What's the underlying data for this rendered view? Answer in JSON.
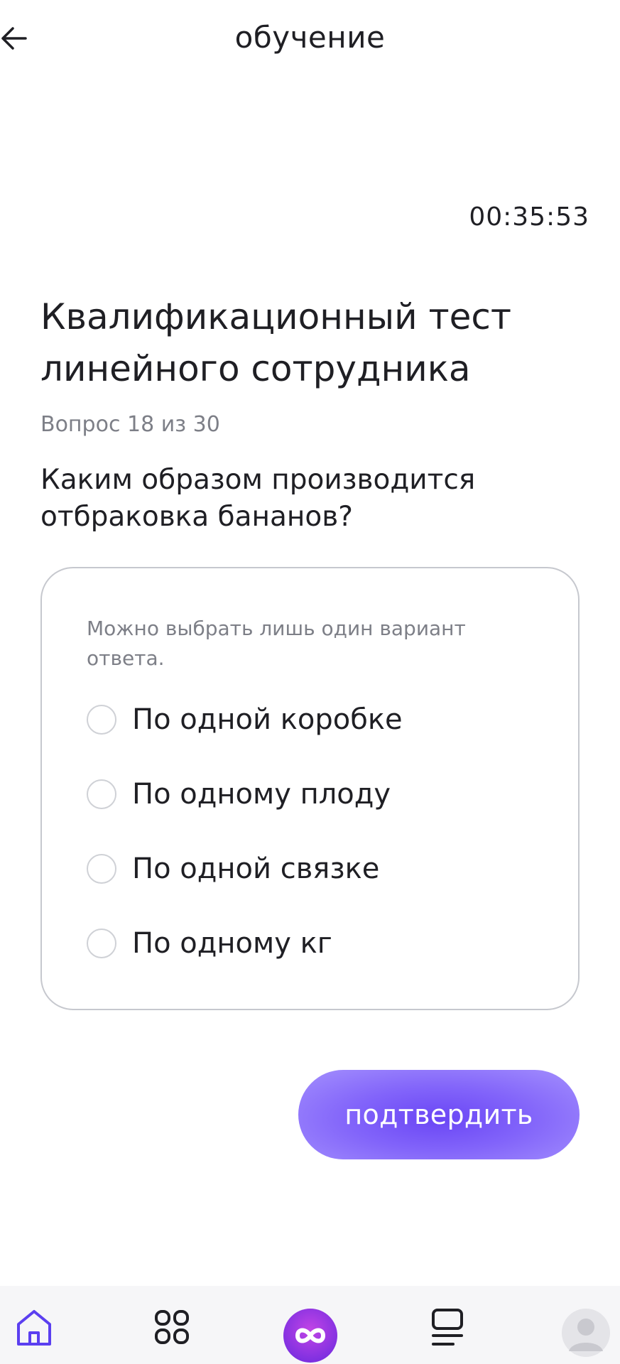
{
  "header": {
    "title": "обучение",
    "back_icon": "arrow-left-icon"
  },
  "timer": "00:35:53",
  "test": {
    "title": "Квалификационный тест линейного сотрудника",
    "counter": "Вопрос 18 из 30",
    "question": "Каким образом производится отбраковка бананов?"
  },
  "answers": {
    "hint": "Можно выбрать лишь один вариант ответа.",
    "options": [
      {
        "label": "По одной коробке"
      },
      {
        "label": "По одному плоду"
      },
      {
        "label": "По одной связке"
      },
      {
        "label": "По одному кг"
      }
    ]
  },
  "confirm_label": "подтвердить",
  "colors": {
    "accent": "#7152F7",
    "text": "#1F1F24",
    "muted": "#7D7F87",
    "border": "#C6C8CE"
  },
  "tabbar": {
    "items": [
      {
        "icon": "home-icon"
      },
      {
        "icon": "grid-icon"
      },
      {
        "icon": "infinity-icon"
      },
      {
        "icon": "list-icon"
      },
      {
        "icon": "avatar-icon"
      }
    ]
  }
}
